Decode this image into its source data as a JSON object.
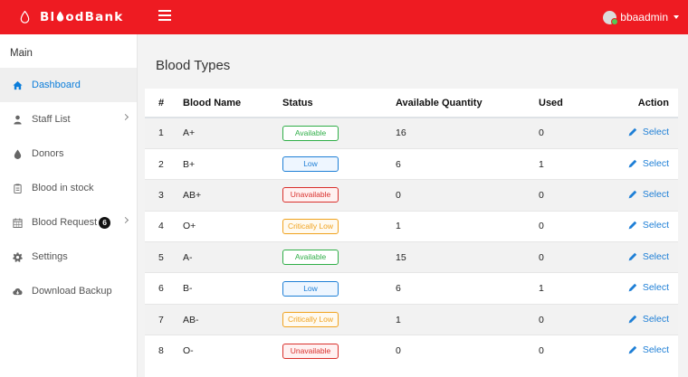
{
  "header": {
    "brand_prefix": "Bl",
    "brand_suffix": "odBank",
    "user_name": "bbaadmin",
    "brand_color": "#ee1b22"
  },
  "sidebar": {
    "section_title": "Main",
    "items": [
      {
        "label": "Dashboard",
        "icon": "home-icon"
      },
      {
        "label": "Staff List",
        "icon": "user-icon"
      },
      {
        "label": "Donors",
        "icon": "drop-icon"
      },
      {
        "label": "Blood in stock",
        "icon": "clipboard-icon"
      },
      {
        "label": "Blood Request",
        "icon": "calendar-icon",
        "badge": "6"
      },
      {
        "label": "Settings",
        "icon": "gear-icon"
      },
      {
        "label": "Download Backup",
        "icon": "cloud-download-icon"
      }
    ]
  },
  "main": {
    "title": "Blood Types",
    "columns": [
      "#",
      "Blood Name",
      "Status",
      "Available Quantity",
      "Used",
      "Action"
    ],
    "rows": [
      {
        "num": "1",
        "name": "A+",
        "status": "Available",
        "qty": "16",
        "used": "0",
        "action": "Select"
      },
      {
        "num": "2",
        "name": "B+",
        "status": "Low",
        "qty": "6",
        "used": "1",
        "action": "Select"
      },
      {
        "num": "3",
        "name": "AB+",
        "status": "Unavailable",
        "qty": "0",
        "used": "0",
        "action": "Select"
      },
      {
        "num": "4",
        "name": "O+",
        "status": "Critically Low",
        "qty": "1",
        "used": "0",
        "action": "Select"
      },
      {
        "num": "5",
        "name": "A-",
        "status": "Available",
        "qty": "15",
        "used": "0",
        "action": "Select"
      },
      {
        "num": "6",
        "name": "B-",
        "status": "Low",
        "qty": "6",
        "used": "1",
        "action": "Select"
      },
      {
        "num": "7",
        "name": "AB-",
        "status": "Critically Low",
        "qty": "1",
        "used": "0",
        "action": "Select"
      },
      {
        "num": "8",
        "name": "O-",
        "status": "Unavailable",
        "qty": "0",
        "used": "0",
        "action": "Select"
      }
    ]
  }
}
